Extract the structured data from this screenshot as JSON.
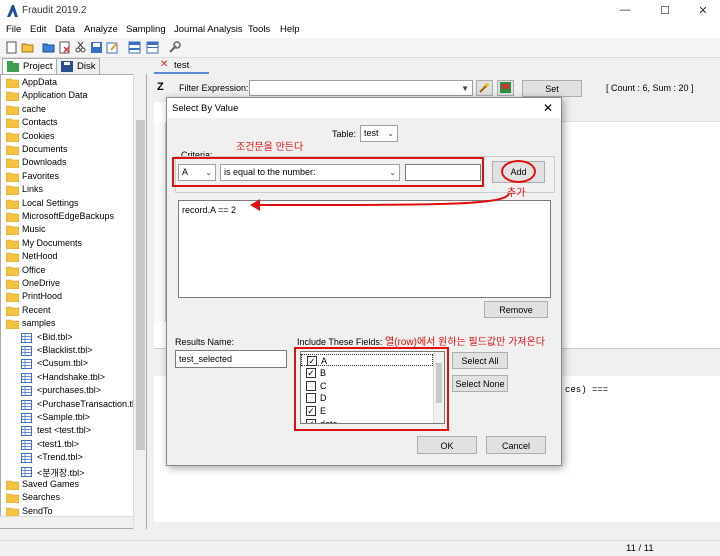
{
  "app": {
    "title": "Fraudit 2019.2",
    "window_controls": [
      "—",
      "☐",
      "✕"
    ]
  },
  "menu": [
    "File",
    "Edit",
    "Data",
    "Analyze",
    "Sampling",
    "Journal Analysis",
    "Tools",
    "Help"
  ],
  "left_tabs": {
    "project": "Project",
    "disk": "Disk"
  },
  "tree": {
    "folders": [
      "AppData",
      "Application Data",
      "cache",
      "Contacts",
      "Cookies",
      "Documents",
      "Downloads",
      "Favorites",
      "Links",
      "Local Settings",
      "MicrosoftEdgeBackups",
      "Music",
      "My Documents",
      "NetHood",
      "Office",
      "OneDrive",
      "PrintHood",
      "Recent",
      "samples"
    ],
    "tables": [
      "<Bid.tbl>",
      "<Blacklist.tbl>",
      "<Cusum.tbl>",
      "<Handshake.tbl>",
      "<purchases.tbl>",
      "<PurchaseTransaction.tbl>",
      "<Sample.tbl>",
      "test <test.tbl>",
      "<test1.tbl>",
      "<Trend.tbl>",
      "<분개장.tbl>"
    ],
    "after": [
      "Saved Games",
      "Searches",
      "SendTo"
    ]
  },
  "doc_tab": {
    "label": "test"
  },
  "filter": {
    "label": "Filter Expression:",
    "value": "",
    "set_label": "Set",
    "summary": "[ Count : 6, Sum : 20 ]"
  },
  "background": {
    "line_text": "ces)  ==="
  },
  "status": {
    "pages": "11 / 11"
  },
  "dialog": {
    "title": "Select By Value",
    "table_label": "Table:",
    "table_value": "test",
    "criteria_label": "Criteria:",
    "field_value": "A",
    "operator_value": "is equal to the number:",
    "number_value": "",
    "add_label": "Add",
    "expression": "record.A == 2",
    "remove_label": "Remove",
    "results_label": "Results Name:",
    "results_value": "test_selected",
    "include_label": "Include These Fields:",
    "fields": [
      {
        "name": "A",
        "checked": true
      },
      {
        "name": "B",
        "checked": true
      },
      {
        "name": "C",
        "checked": false
      },
      {
        "name": "D",
        "checked": false
      },
      {
        "name": "E",
        "checked": true
      },
      {
        "name": "date",
        "checked": true
      }
    ],
    "select_all_label": "Select All",
    "select_none_label": "Select None",
    "ok_label": "OK",
    "cancel_label": "Cancel"
  },
  "annotations": {
    "criteria_note": "조건문을 만든다",
    "add_note": "추가",
    "fields_note": "열(row)에서 원하는 필드값만 가져온다"
  },
  "colors": {
    "annotation_red": "#e01010",
    "folder": "#f5c342",
    "accent": "#5b8bd0"
  }
}
